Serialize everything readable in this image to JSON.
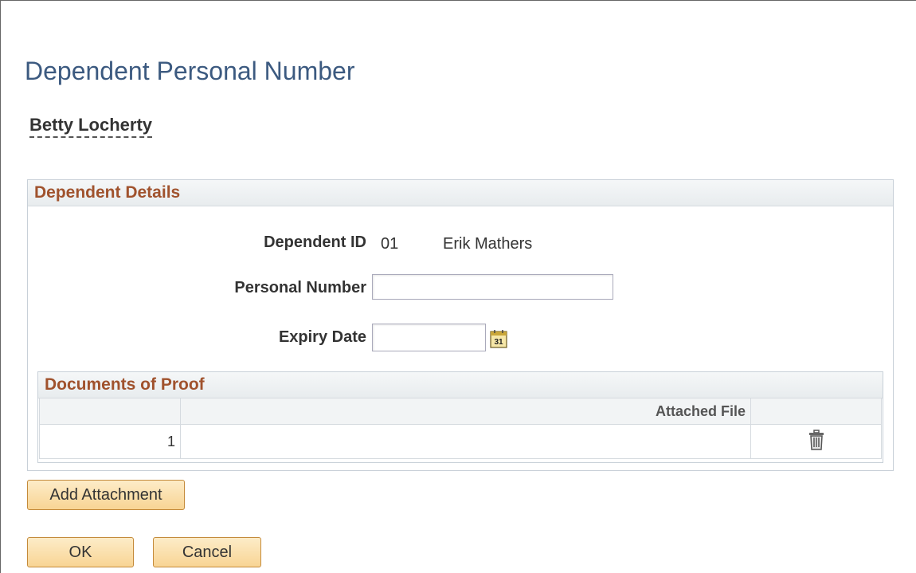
{
  "page": {
    "title": "Dependent Personal Number",
    "employee_name": "Betty Locherty"
  },
  "dependent_details": {
    "header": "Dependent Details",
    "dependent_id_label": "Dependent ID",
    "dependent_id_value": "01",
    "dependent_name": "Erik Mathers",
    "personal_number_label": "Personal Number",
    "personal_number_value": "",
    "expiry_date_label": "Expiry Date",
    "expiry_date_value": "",
    "calendar_icon_text": "31"
  },
  "documents_of_proof": {
    "header": "Documents of Proof",
    "columns": [
      "",
      "Attached File",
      ""
    ],
    "rows": [
      {
        "row_number": "1",
        "attached_file": ""
      }
    ]
  },
  "buttons": {
    "add_attachment": "Add Attachment",
    "ok": "OK",
    "cancel": "Cancel"
  },
  "icons": {
    "delete": "trash-icon",
    "calendar": "calendar-icon"
  }
}
